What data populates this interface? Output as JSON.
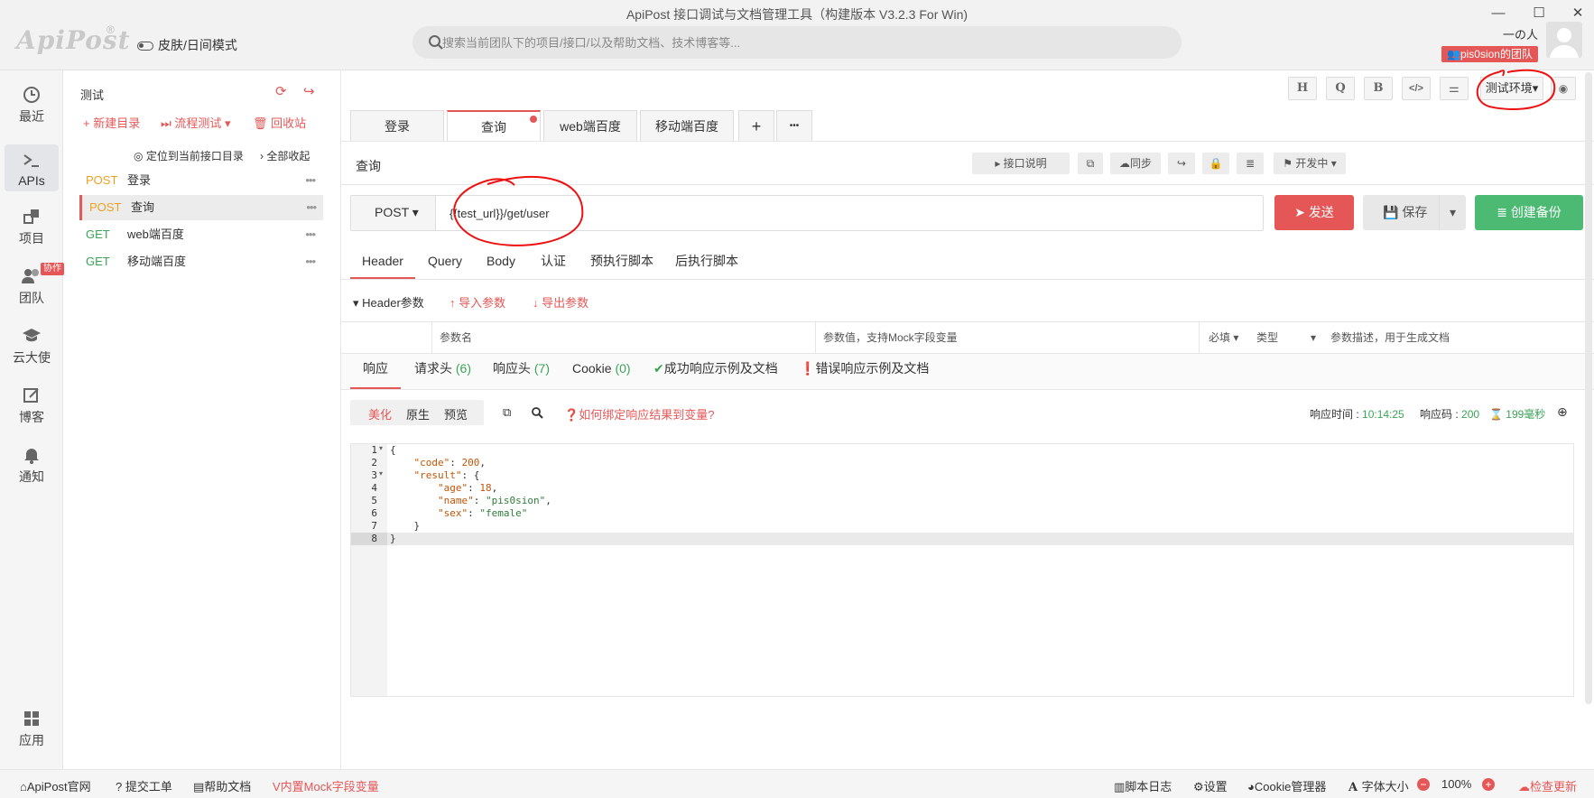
{
  "window": {
    "title": "ApiPost 接口调试与文档管理工具（构建版本 V3.2.3 For Win)",
    "minimize": "—",
    "maximize": "☐",
    "close": "✕"
  },
  "header": {
    "logo": "ApiPost",
    "logo_mark": "®",
    "skin_toggle": "皮肤/日间模式",
    "search_placeholder": "搜索当前团队下的项目/接口/以及帮助文档、技术博客等...",
    "username": "一の人",
    "team_badge": "pis0sion的团队"
  },
  "nav": [
    {
      "label": "最近",
      "icon": "clock-icon"
    },
    {
      "label": "APIs",
      "icon": "terminal-icon"
    },
    {
      "label": "项目",
      "icon": "project-icon"
    },
    {
      "label": "团队",
      "icon": "team-icon"
    },
    {
      "label": "云大使",
      "icon": "graduation-cap-icon"
    },
    {
      "label": "博客",
      "icon": "edit-icon"
    },
    {
      "label": "通知",
      "icon": "bell-icon"
    },
    {
      "label": "应用",
      "icon": "apps-icon"
    }
  ],
  "nav_badge": "协作",
  "tree": {
    "title": "测试",
    "new_dir": "+ 新建目录",
    "flow_test": "流程测试",
    "recycle": "回收站",
    "locate": "定位到当前接口目录",
    "collapse": "全部收起",
    "items": [
      {
        "method": "POST",
        "name": "登录"
      },
      {
        "method": "POST",
        "name": "查询"
      },
      {
        "method": "GET",
        "name": "web端百度"
      },
      {
        "method": "GET",
        "name": "移动端百度"
      }
    ]
  },
  "toolbar": {
    "h": "H",
    "q": "Q",
    "b": "B",
    "code": "</>",
    "sliders": "⚌",
    "env": "测试环境",
    "eye": "◉"
  },
  "tabs": [
    {
      "label": "登录"
    },
    {
      "label": "查询"
    },
    {
      "label": "web端百度"
    },
    {
      "label": "移动端百度"
    }
  ],
  "tab_add": "+",
  "tab_more": "•••",
  "api": {
    "name": "查询",
    "doc_btn": "接口说明",
    "sync": "同步",
    "status": "开发中",
    "method": "POST",
    "url": "{{test_url}}/get/user",
    "send": "发送",
    "save": "保存",
    "backup": "创建备份"
  },
  "req_tabs": [
    "Header",
    "Query",
    "Body",
    "认证",
    "预执行脚本",
    "后执行脚本"
  ],
  "header_params": {
    "title": "Header参数",
    "import": "导入参数",
    "export": "导出参数",
    "col_name": "参数名",
    "col_value": "参数值，支持Mock字段变量",
    "col_required": "必填",
    "col_type": "类型",
    "col_desc": "参数描述，用于生成文档"
  },
  "res_tabs": [
    {
      "label": "响应",
      "count": ""
    },
    {
      "label": "请求头",
      "count": "(6)"
    },
    {
      "label": "响应头",
      "count": "(7)"
    },
    {
      "label": "Cookie",
      "count": "(0)"
    },
    {
      "label": "成功响应示例及文档",
      "count": ""
    },
    {
      "label": "错误响应示例及文档",
      "count": ""
    }
  ],
  "res_toolbar": {
    "pretty": "美化",
    "raw": "原生",
    "preview": "预览",
    "help": "如何绑定响应结果到变量?",
    "time_label": "响应时间 : ",
    "time": "10:14:25",
    "code_label": "响应码 : ",
    "code": "200",
    "duration": "199毫秒"
  },
  "response_lines": [
    "1",
    "2",
    "3",
    "4",
    "5",
    "6",
    "7",
    "8"
  ],
  "status_bar": {
    "official": "ApiPost官网",
    "ticket": "提交工单",
    "help": "帮助文档",
    "mock": "内置Mock字段变量",
    "script_log": "脚本日志",
    "settings": "设置",
    "cookie": "Cookie管理器",
    "font": "字体大小",
    "zoom": "100%",
    "update": "检查更新"
  }
}
